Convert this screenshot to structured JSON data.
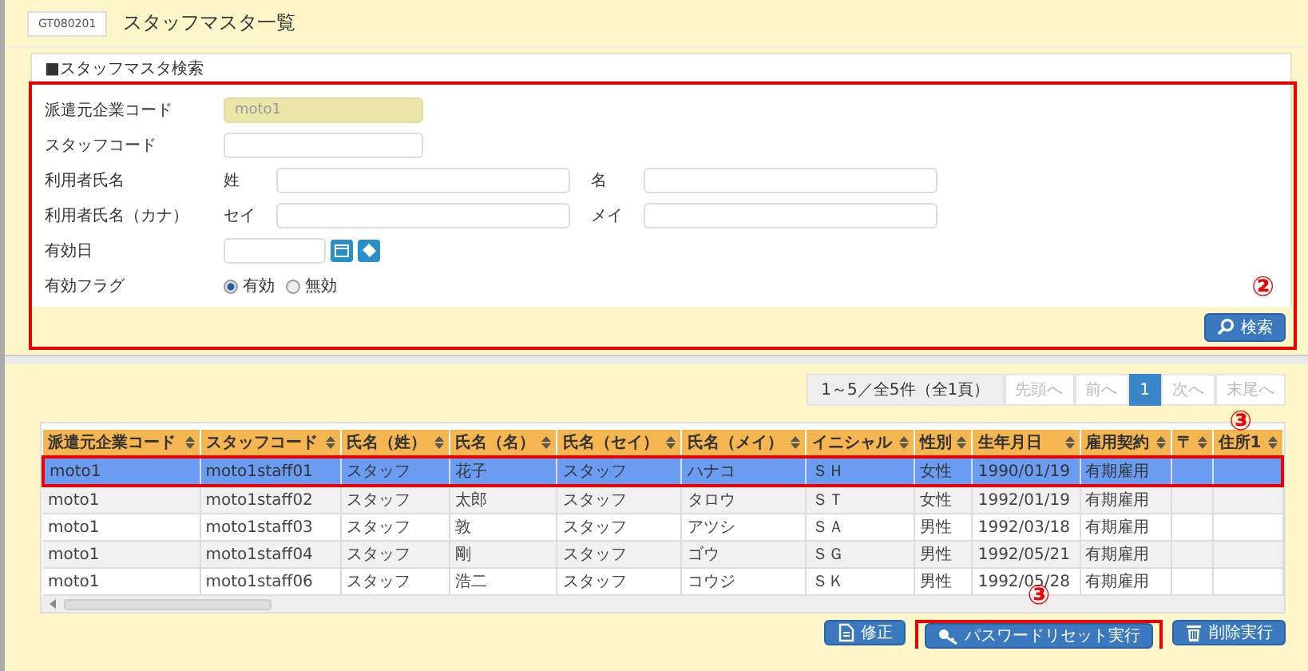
{
  "header": {
    "screen_id": "GT080201",
    "title": "スタッフマスタ一覧"
  },
  "search": {
    "title": "■スタッフマスタ検索",
    "annotation": "②",
    "search_button": "検索",
    "fields": [
      {
        "kind": "readonly",
        "label": "派遣元企業コード",
        "value": "moto1"
      },
      {
        "kind": "text",
        "label": "スタッフコード"
      },
      {
        "kind": "pair",
        "label": "利用者氏名",
        "parts": [
          "姓",
          "名"
        ]
      },
      {
        "kind": "pair",
        "label": "利用者氏名（カナ）",
        "parts": [
          "セイ",
          "メイ"
        ]
      },
      {
        "kind": "date",
        "label": "有効日"
      },
      {
        "kind": "radio",
        "label": "有効フラグ",
        "options": [
          {
            "label": "有効",
            "selected": true
          },
          {
            "label": "無効",
            "selected": false
          }
        ]
      }
    ]
  },
  "pager": {
    "info": "1～5／全5件（全1頁）",
    "buttons": [
      {
        "label": "先頭へ",
        "selected": false,
        "disabled": true
      },
      {
        "label": "前へ",
        "selected": false,
        "disabled": true
      },
      {
        "label": "1",
        "selected": true,
        "disabled": false
      },
      {
        "label": "次へ",
        "selected": false,
        "disabled": true
      },
      {
        "label": "末尾へ",
        "selected": false,
        "disabled": true
      }
    ]
  },
  "table": {
    "annotation": "③",
    "columns": [
      "派遣元企業コード",
      "スタッフコード",
      "氏名（姓）",
      "氏名（名）",
      "氏名（セイ）",
      "氏名（メイ）",
      "イニシャル",
      "性別",
      "生年月日",
      "雇用契約",
      "〒",
      "住所1"
    ],
    "rows": [
      {
        "selected": true,
        "framed": true,
        "cells": [
          "moto1",
          "moto1staff01",
          "スタッフ",
          "花子",
          "スタッフ",
          "ハナコ",
          "ＳＨ",
          "女性",
          "1990/01/19",
          "有期雇用",
          "",
          ""
        ]
      },
      {
        "selected": false,
        "framed": false,
        "cells": [
          "moto1",
          "moto1staff02",
          "スタッフ",
          "太郎",
          "スタッフ",
          "タロウ",
          "ＳＴ",
          "女性",
          "1992/01/19",
          "有期雇用",
          "",
          ""
        ]
      },
      {
        "selected": false,
        "framed": false,
        "cells": [
          "moto1",
          "moto1staff03",
          "スタッフ",
          "敦",
          "スタッフ",
          "アツシ",
          "ＳＡ",
          "男性",
          "1992/03/18",
          "有期雇用",
          "",
          ""
        ]
      },
      {
        "selected": false,
        "framed": false,
        "cells": [
          "moto1",
          "moto1staff04",
          "スタッフ",
          "剛",
          "スタッフ",
          "ゴウ",
          "ＳＧ",
          "男性",
          "1992/05/21",
          "有期雇用",
          "",
          ""
        ]
      },
      {
        "selected": false,
        "framed": false,
        "cells": [
          "moto1",
          "moto1staff06",
          "スタッフ",
          "浩二",
          "スタッフ",
          "コウジ",
          "ＳＫ",
          "男性",
          "1992/05/28",
          "有期雇用",
          "",
          ""
        ]
      }
    ]
  },
  "actions": [
    {
      "kind": "edit",
      "label": "修正",
      "framed": false
    },
    {
      "kind": "key",
      "label": "パスワードリセット実行",
      "framed": true,
      "annotation": "③"
    },
    {
      "kind": "delete",
      "label": "削除実行",
      "framed": false
    }
  ]
}
